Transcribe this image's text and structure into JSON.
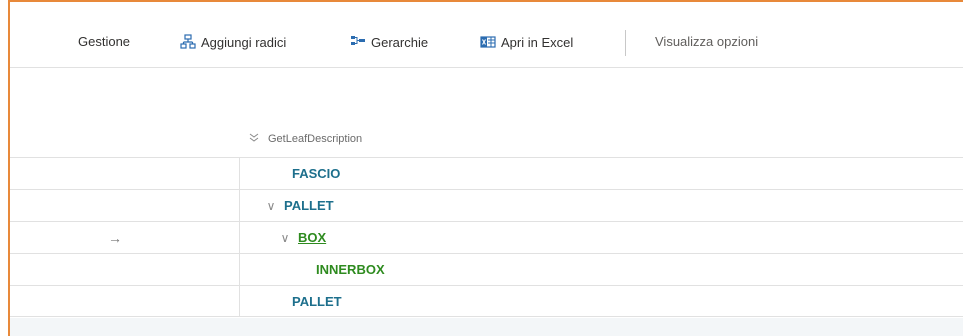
{
  "toolbar": {
    "manage": "Gestione",
    "add_roots": "Aggiungi radici",
    "hierarchies": "Gerarchie",
    "open_excel": "Apri in Excel",
    "view_options": "Visualizza opzioni"
  },
  "column": {
    "header": "GetLeafDescription"
  },
  "rows": [
    {
      "label": "FASCIO",
      "indent": 0,
      "expandable": false,
      "current": false,
      "color": "#1d6f8c"
    },
    {
      "label": "PALLET",
      "indent": 0,
      "expandable": true,
      "current": false,
      "color": "#1d6f8c"
    },
    {
      "label": "BOX",
      "indent": 1,
      "expandable": true,
      "current": true,
      "color": "#2e8b1f"
    },
    {
      "label": "INNERBOX",
      "indent": 2,
      "expandable": false,
      "current": false,
      "color": "#2e8b1f"
    },
    {
      "label": "PALLET",
      "indent": 0,
      "expandable": false,
      "current": false,
      "color": "#1d6f8c"
    }
  ],
  "colors": {
    "accent_border": "#e8893a",
    "link_blue": "#1d6f8c",
    "link_green": "#2e8b1f"
  }
}
